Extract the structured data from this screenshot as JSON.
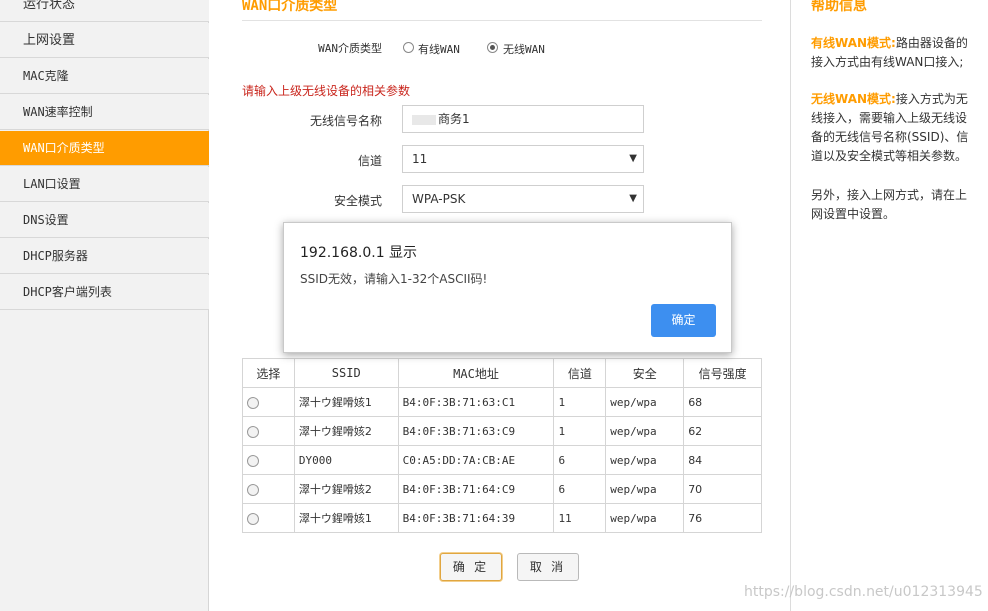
{
  "sidebar": {
    "items": [
      {
        "label": "运行状态"
      },
      {
        "label": "上网设置"
      },
      {
        "label": "MAC克隆"
      },
      {
        "label": "WAN速率控制"
      },
      {
        "label": "WAN口介质类型",
        "active": true
      },
      {
        "label": "LAN口设置"
      },
      {
        "label": "DNS设置"
      },
      {
        "label": "DHCP服务器"
      },
      {
        "label": "DHCP客户端列表"
      }
    ]
  },
  "main": {
    "title": "WAN口介质类型",
    "media_type_label": "WAN介质类型",
    "media_options": [
      {
        "label": "有线WAN",
        "checked": false
      },
      {
        "label": "无线WAN",
        "checked": true
      }
    ],
    "section_note": "请输入上级无线设备的相关参数",
    "ssid_label": "无线信号名称",
    "ssid_value": "商务1",
    "channel_label": "信道",
    "channel_value": "11",
    "security_label": "安全模式",
    "security_value": "WPA-PSK"
  },
  "dialog": {
    "title": "192.168.0.1 显示",
    "message": "SSID无效，请输入1-32个ASCII码!",
    "ok_label": "确定"
  },
  "table": {
    "headers": [
      "选择",
      "SSID",
      "MAC地址",
      "信道",
      "安全",
      "信号强度"
    ],
    "rows": [
      {
        "ssid": "濢十ウ鍟嗗姟1",
        "mac": "B4:0F:3B:71:63:C1",
        "channel": "1",
        "security": "wep/wpa",
        "signal": "68"
      },
      {
        "ssid": "濢十ウ鍟嗗姟2",
        "mac": "B4:0F:3B:71:63:C9",
        "channel": "1",
        "security": "wep/wpa",
        "signal": "62"
      },
      {
        "ssid": "DY000",
        "mac": "C0:A5:DD:7A:CB:AE",
        "channel": "6",
        "security": "wep/wpa",
        "signal": "84"
      },
      {
        "ssid": "濢十ウ鍟嗗姟2",
        "mac": "B4:0F:3B:71:64:C9",
        "channel": "6",
        "security": "wep/wpa",
        "signal": "70"
      },
      {
        "ssid": "濢十ウ鍟嗗姟1",
        "mac": "B4:0F:3B:71:64:39",
        "channel": "11",
        "security": "wep/wpa",
        "signal": "76"
      }
    ]
  },
  "buttons": {
    "ok": "确 定",
    "cancel": "取 消"
  },
  "help": {
    "title": "帮助信息",
    "p1_key": "有线WAN模式:",
    "p1_text": "路由器设备的接入方式由有线WAN口接入;",
    "p2_key": "无线WAN模式:",
    "p2_text": "接入方式为无线接入，需要输入上级无线设备的无线信号名称(SSID)、信道以及安全模式等相关参数。",
    "p3_text": "另外，接入上网方式，请在上网设置中设置。"
  },
  "watermark": "https://blog.csdn.net/u012313945",
  "colors": {
    "accent": "#ff9c00",
    "warning": "#c9261d",
    "dialog_button": "#3d8ff0"
  }
}
